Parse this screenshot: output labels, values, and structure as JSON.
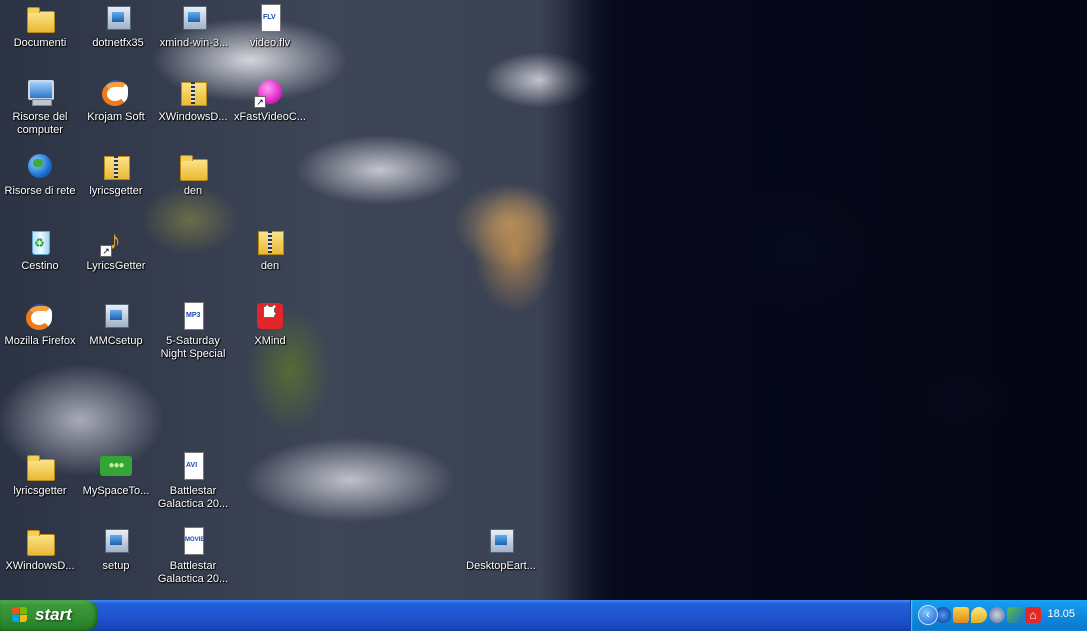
{
  "desktop": {
    "icons": [
      {
        "label": "Documenti"
      },
      {
        "label": "dotnetfx35"
      },
      {
        "label": "xmind-win-3..."
      },
      {
        "label": "video.flv"
      },
      {
        "label": "Risorse del\ncomputer"
      },
      {
        "label": "Krojam Soft"
      },
      {
        "label": "XWindowsD..."
      },
      {
        "label": "xFastVideoC..."
      },
      {
        "label": "Risorse di rete"
      },
      {
        "label": "lyricsgetter"
      },
      {
        "label": "den"
      },
      {
        "label": "Cestino"
      },
      {
        "label": "LyricsGetter"
      },
      {
        "label": "den"
      },
      {
        "label": "Mozilla Firefox"
      },
      {
        "label": "MMCsetup"
      },
      {
        "label": "5-Saturday\nNight Special"
      },
      {
        "label": "XMind"
      },
      {
        "label": "lyricsgetter"
      },
      {
        "label": "MySpaceTo..."
      },
      {
        "label": "Battlestar\nGalactica 20..."
      },
      {
        "label": "XWindowsD..."
      },
      {
        "label": "setup"
      },
      {
        "label": "Battlestar\nGalactica 20..."
      },
      {
        "label": "DesktopEart..."
      }
    ],
    "badges": {
      "flv": "FLV",
      "mp3": "MP3",
      "avi": "AVI",
      "movie": "MOVIE"
    }
  },
  "taskbar": {
    "start_label": "start",
    "tray_expand": "‹",
    "clock": "18.05"
  },
  "colors": {
    "taskbar_blue": "#245edb",
    "start_green": "#3c9a3c",
    "tray_blue": "#0e8ae0"
  }
}
